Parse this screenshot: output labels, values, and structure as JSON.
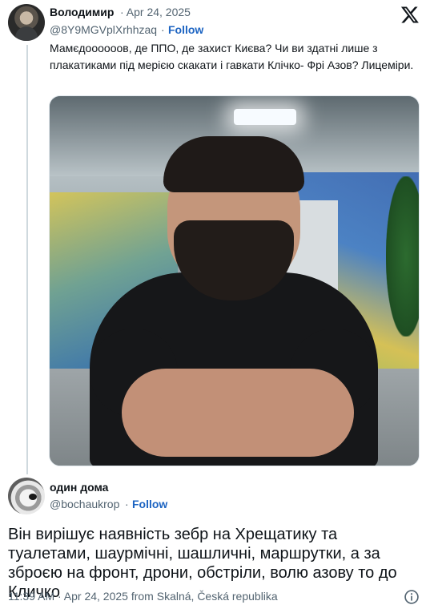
{
  "parent_tweet": {
    "author_name": "Володимир",
    "date": "· Apr 24, 2025",
    "handle": "@8Y9MGVplXrhhzaq",
    "separator": "·",
    "follow_label": "Follow",
    "text": "Мамєдоооооов, де ППО, де захист Києва? Чи ви здатні лише з плакатиками під мерією скакати і гавкати Клічко- Фрі Азов? Лицеміри."
  },
  "reply_tweet": {
    "author_name": "один дома",
    "handle": "@bochaukrop",
    "separator": "·",
    "follow_label": "Follow",
    "text": "Він вирішує наявність зебр на Хрещатику та туалетами, шаурмічні, шашличні, маршрутки, а  за зброєю на фронт, дрони, обстріли, волю азову то до Кличко",
    "meta": "11:39 AM · Apr 24, 2025 from Skalná, Česká republika"
  },
  "icons": {
    "brand": "x-logo-icon",
    "info": "info-icon"
  },
  "colors": {
    "link": "#1d64c2",
    "secondary_text": "#536471",
    "thread_line": "#cfd9de"
  }
}
